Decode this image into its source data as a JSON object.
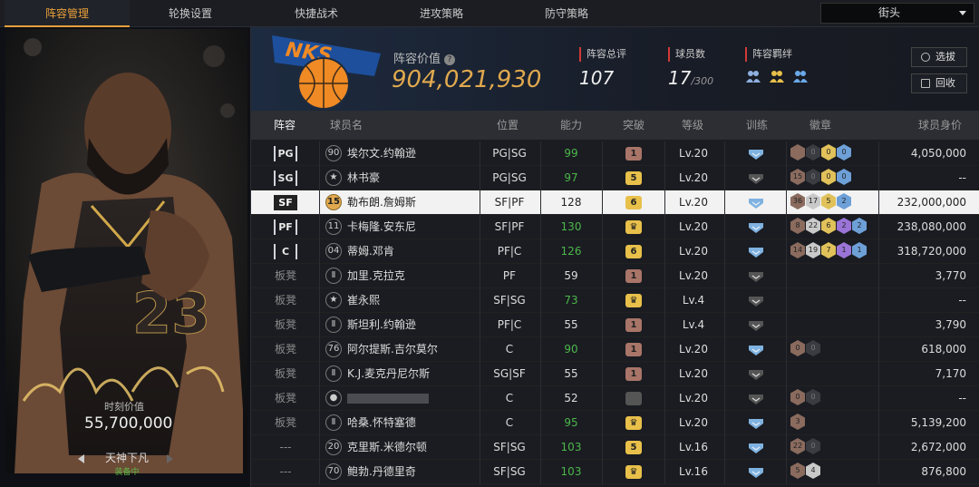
{
  "tabs": [
    "阵容管理",
    "轮换设置",
    "快捷战术",
    "进攻策略",
    "防守策略"
  ],
  "court_select": "街头",
  "card": {
    "label": "时刻价值",
    "value": "55,700,000",
    "skin_name": "天神下凡",
    "skin_status": "装备中",
    "jersey_number": "23"
  },
  "header": {
    "lineup_value_label": "阵容价值",
    "lineup_value": "904,021,930",
    "stats": [
      {
        "label": "阵容总评",
        "value": "107",
        "suffix": ""
      },
      {
        "label": "球员数",
        "value": "17",
        "suffix": "/300"
      },
      {
        "label": "阵容羁绊",
        "value": "",
        "suffix": ""
      }
    ],
    "buttons": [
      "选拔",
      "回收"
    ]
  },
  "columns": [
    "阵容",
    "球员名",
    "位置",
    "能力",
    "突破",
    "等级",
    "训练",
    "徽章",
    "球员身价"
  ],
  "rows": [
    {
      "slot": "PG",
      "starter": true,
      "num": "90",
      "name": "埃尔文.约翰逊",
      "position": "PG|SG",
      "power": "99",
      "power_green": true,
      "brk": "1",
      "brk_c": "r",
      "level": "Lv.20",
      "train": "blue",
      "badges": [
        [
          "",
          "hx-b"
        ],
        [
          "0",
          "hx-e"
        ],
        [
          "0",
          "hx-g"
        ],
        [
          "0",
          "hx-c"
        ]
      ],
      "value": "4,050,000"
    },
    {
      "slot": "SG",
      "starter": true,
      "num": "★",
      "name": "林书豪",
      "position": "PG|SG",
      "power": "97",
      "power_green": true,
      "brk": "5",
      "brk_c": "y",
      "level": "Lv.20",
      "train": "gray",
      "badges": [
        [
          "15",
          "hx-b"
        ],
        [
          "0",
          "hx-e"
        ],
        [
          "0",
          "hx-g"
        ],
        [
          "0",
          "hx-c"
        ]
      ],
      "value": "--"
    },
    {
      "slot": "SF",
      "starter": true,
      "num": "15",
      "name": "勒布朗.詹姆斯",
      "position": "SF|PF",
      "power": "128",
      "power_green": false,
      "brk": "6",
      "brk_c": "y",
      "level": "Lv.20",
      "train": "blue",
      "badges": [
        [
          "36",
          "hx-b"
        ],
        [
          "17",
          "hx-s"
        ],
        [
          "5",
          "hx-g"
        ],
        [
          "2",
          "hx-c"
        ]
      ],
      "value": "232,000,000"
    },
    {
      "slot": "PF",
      "starter": true,
      "num": "11",
      "name": "卡梅隆.安东尼",
      "position": "SF|PF",
      "power": "130",
      "power_green": true,
      "brk": "♛",
      "brk_c": "y",
      "level": "Lv.20",
      "train": "blue",
      "badges": [
        [
          "8",
          "hx-b"
        ],
        [
          "22",
          "hx-s"
        ],
        [
          "6",
          "hx-g"
        ],
        [
          "2",
          "hx-p"
        ],
        [
          "2",
          "hx-c"
        ]
      ],
      "value": "238,080,000"
    },
    {
      "slot": "C",
      "starter": true,
      "num": "04",
      "name": "蒂姆.邓肯",
      "position": "PF|C",
      "power": "126",
      "power_green": true,
      "brk": "6",
      "brk_c": "y",
      "level": "Lv.20",
      "train": "blue",
      "badges": [
        [
          "14",
          "hx-b"
        ],
        [
          "19",
          "hx-s"
        ],
        [
          "7",
          "hx-g"
        ],
        [
          "1",
          "hx-p"
        ],
        [
          "1",
          "hx-c"
        ]
      ],
      "value": "318,720,000"
    },
    {
      "slot": "板凳",
      "starter": false,
      "num": "Ⅱ",
      "name": "加里.克拉克",
      "position": "PF",
      "power": "59",
      "power_green": false,
      "brk": "1",
      "brk_c": "r",
      "level": "Lv.20",
      "train": "gray",
      "badges": [],
      "value": "3,770"
    },
    {
      "slot": "板凳",
      "starter": false,
      "num": "★",
      "name": "崔永熙",
      "position": "SF|SG",
      "power": "73",
      "power_green": true,
      "brk": "♛",
      "brk_c": "y",
      "level": "Lv.4",
      "train": "gray",
      "badges": [],
      "value": "--"
    },
    {
      "slot": "板凳",
      "starter": false,
      "num": "Ⅱ",
      "name": "斯坦利.约翰逊",
      "position": "PF|C",
      "power": "55",
      "power_green": false,
      "brk": "1",
      "brk_c": "r",
      "level": "Lv.4",
      "train": "gray",
      "badges": [],
      "value": "3,790"
    },
    {
      "slot": "板凳",
      "starter": false,
      "num": "76",
      "name": "阿尔提斯.吉尔莫尔",
      "position": "C",
      "power": "90",
      "power_green": true,
      "brk": "1",
      "brk_c": "r",
      "level": "Lv.20",
      "train": "blue",
      "badges": [
        [
          "0",
          "hx-b"
        ],
        [
          "0",
          "hx-e"
        ]
      ],
      "value": "618,000"
    },
    {
      "slot": "板凳",
      "starter": false,
      "num": "Ⅱ",
      "name": "K.J.麦克丹尼尔斯",
      "position": "SG|SF",
      "power": "55",
      "power_green": false,
      "brk": "1",
      "brk_c": "r",
      "level": "Lv.20",
      "train": "gray",
      "badges": [],
      "value": "7,170"
    },
    {
      "slot": "板凳",
      "starter": false,
      "num": "●",
      "name": "",
      "position": "C",
      "power": "52",
      "power_green": false,
      "brk": "",
      "brk_c": "d",
      "level": "Lv.20",
      "train": "gray",
      "badges": [
        [
          "0",
          "hx-b"
        ],
        [
          "0",
          "hx-e"
        ]
      ],
      "value": "--"
    },
    {
      "slot": "板凳",
      "starter": false,
      "num": "Ⅱ",
      "name": "哈桑.怀特塞德",
      "position": "C",
      "power": "95",
      "power_green": true,
      "brk": "♛",
      "brk_c": "y",
      "level": "Lv.20",
      "train": "blue",
      "badges": [
        [
          "3",
          "hx-b"
        ]
      ],
      "value": "5,139,200"
    },
    {
      "slot": "---",
      "starter": false,
      "num": "20",
      "name": "克里斯.米德尔顿",
      "position": "SF|SG",
      "power": "103",
      "power_green": true,
      "brk": "5",
      "brk_c": "y",
      "level": "Lv.16",
      "train": "blue",
      "badges": [
        [
          "22",
          "hx-b"
        ],
        [
          "0",
          "hx-e"
        ]
      ],
      "value": "2,672,000"
    },
    {
      "slot": "---",
      "starter": false,
      "num": "70",
      "name": "鲍勃.丹德里奇",
      "position": "SF|SG",
      "power": "103",
      "power_green": true,
      "brk": "♛",
      "brk_c": "y",
      "level": "Lv.16",
      "train": "blue",
      "badges": [
        [
          "5",
          "hx-b"
        ],
        [
          "4",
          "hx-s"
        ]
      ],
      "value": "876,800"
    }
  ]
}
